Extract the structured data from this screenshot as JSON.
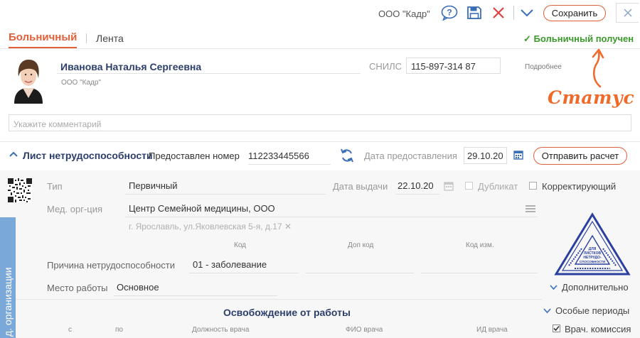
{
  "header": {
    "org": "ООО \"Кадр\"",
    "save_label": "Сохранить",
    "tabs": [
      {
        "label": "Больничный",
        "active": true
      },
      {
        "label": "Лента",
        "active": false
      }
    ],
    "status": "Больничный получен",
    "status_check": "✓"
  },
  "employee": {
    "name": "Иванова Наталья Сергеевна",
    "org": "ООО \"Кадр\"",
    "snils_label": "СНИЛС",
    "snils_value": "115-897-314 87",
    "details_link": "Подробнее",
    "comment_placeholder": "Укажите комментарий"
  },
  "annotation": {
    "text": "Статус"
  },
  "sick_list": {
    "title": "Лист нетрудоспособности",
    "number_label": "Предоставлен номер",
    "number_value": "112233445566",
    "date_label": "Дата предоставления",
    "date_value": "29.10.20",
    "send_label": "Отправить расчет"
  },
  "form": {
    "type_label": "Тип",
    "type_value": "Первичный",
    "issue_date_label": "Дата выдачи",
    "issue_date_value": "22.10.20",
    "duplicate_label": "Дубликат",
    "corrective_label": "Корректирующий",
    "med_org_label": "Мед. орг-ция",
    "med_org_value": "Центр Семейной медицины, ООО",
    "med_org_address": "г. Ярославль, ул.Яковлевская 5-я, д.17",
    "code_header": "Код",
    "add_code_header": "Доп код",
    "code_change_header": "Код изм.",
    "reason_label": "Причина нетрудоспособности",
    "reason_value": "01 - заболевание",
    "workplace_label": "Место работы",
    "workplace_value": "Основное",
    "more_label": "Дополнительно",
    "side_tab": "д. организации",
    "release_title": "Освобождение от работы",
    "special_periods_label": "Особые периоды",
    "col_from": "с",
    "col_to": "по",
    "col_position": "Должность врача",
    "col_fio": "ФИО врача",
    "col_id": "ИД врача",
    "commission_label": "Врач. комиссия"
  },
  "stamp": {
    "lines": [
      "ДЛЯ",
      "ЛИСТКОВ",
      "НЕТРУДО-",
      "СПОСОБНОСТИ"
    ]
  },
  "colors": {
    "accent": "#e0603a",
    "status_green": "#3a9a2a",
    "link_blue": "#3a6fb7",
    "stamp_blue": "#2a3fa0",
    "side_tab_blue": "#7aa8d8"
  }
}
